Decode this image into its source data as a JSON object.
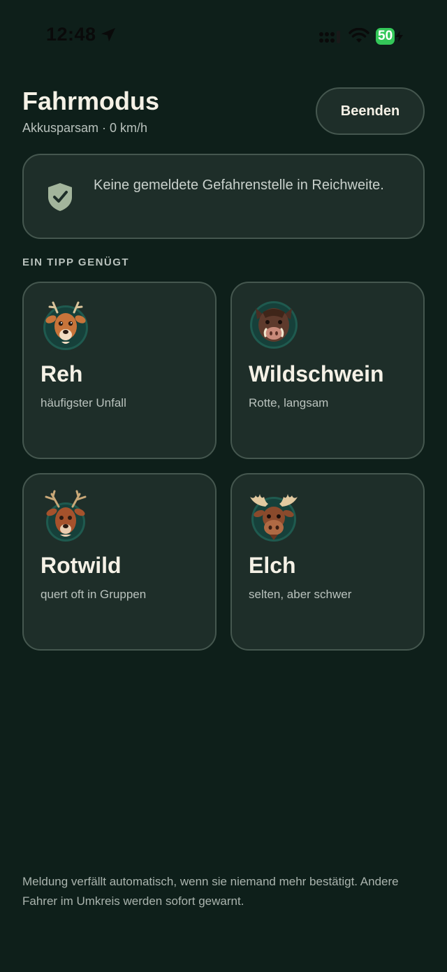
{
  "status_bar": {
    "time": "12:48",
    "battery": "50"
  },
  "header": {
    "title": "Fahrmodus",
    "subtitle": "Akkusparsam · 0 km/h",
    "end_button": "Beenden"
  },
  "alert": {
    "text": "Keine gemeldete Gefahrenstelle in Reichweite."
  },
  "section_label": "EIN TIPP GENÜGT",
  "animals": [
    {
      "name": "Reh",
      "desc": "häufigster Unfall",
      "icon": "deer-icon"
    },
    {
      "name": "Wildschwein",
      "desc": "Rotte, langsam",
      "icon": "boar-icon"
    },
    {
      "name": "Rotwild",
      "desc": "quert oft in Gruppen",
      "icon": "red-deer-icon"
    },
    {
      "name": "Elch",
      "desc": "selten, aber schwer",
      "icon": "moose-icon"
    }
  ],
  "footer": "Meldung verfällt automatisch, wenn sie niemand mehr bestätigt. Andere Fahrer im Umkreis werden sofort gewarnt.",
  "colors": {
    "background": "#0e1f1a",
    "card": "#1e2e29",
    "border": "#45574f",
    "battery": "#34c759"
  }
}
